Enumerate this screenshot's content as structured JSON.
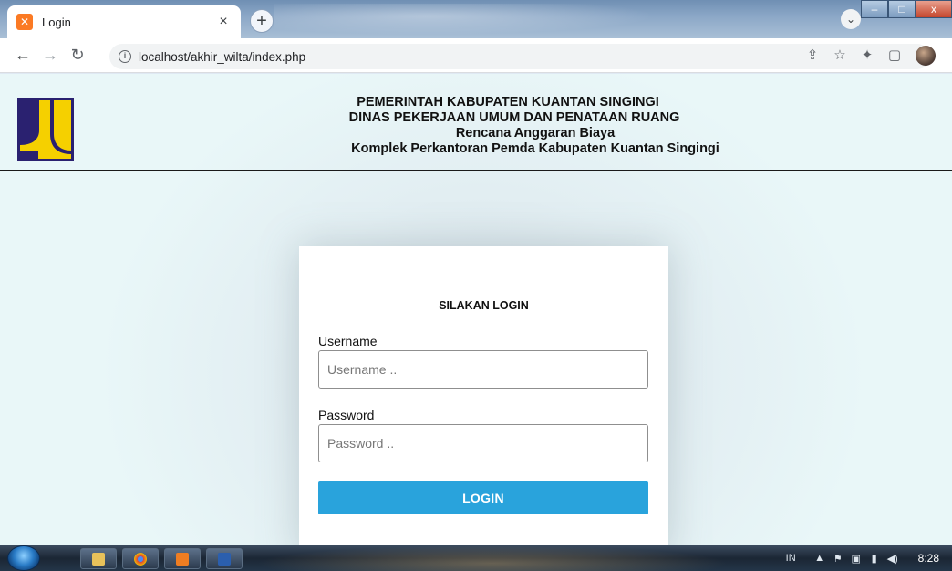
{
  "browser": {
    "tab": {
      "title": "Login",
      "close_glyph": "×"
    },
    "new_tab_glyph": "+",
    "address": {
      "url": "localhost/akhir_wilta/index.php"
    },
    "window_controls": {
      "minimize": "–",
      "maximize": "□",
      "close": "x"
    }
  },
  "header": {
    "line1": "PEMERINTAH KABUPATEN KUANTAN SINGINGI",
    "line2": "DINAS PEKERJAAN UMUM DAN PENATAAN RUANG",
    "line3": "Rencana Anggaran Biaya",
    "line4": "Komplek Perkantoran Pemda Kabupaten Kuantan Singingi"
  },
  "login": {
    "title": "SILAKAN LOGIN",
    "username_label": "Username",
    "username_placeholder": "Username ..",
    "password_label": "Password",
    "password_placeholder": "Password ..",
    "button": "LOGIN"
  },
  "taskbar": {
    "lang": "IN",
    "clock": "8:28"
  },
  "colors": {
    "page_bg": "#e9f7f8",
    "button": "#29a3dc",
    "logo_yellow": "#f5d000",
    "logo_navy": "#2a2170"
  },
  "icons": [
    "xampp-favicon-icon",
    "back-arrow-icon",
    "forward-arrow-icon",
    "reload-icon",
    "info-icon",
    "share-icon",
    "star-icon",
    "extensions-icon",
    "sidepanel-icon",
    "profile-avatar",
    "pu-logo"
  ]
}
